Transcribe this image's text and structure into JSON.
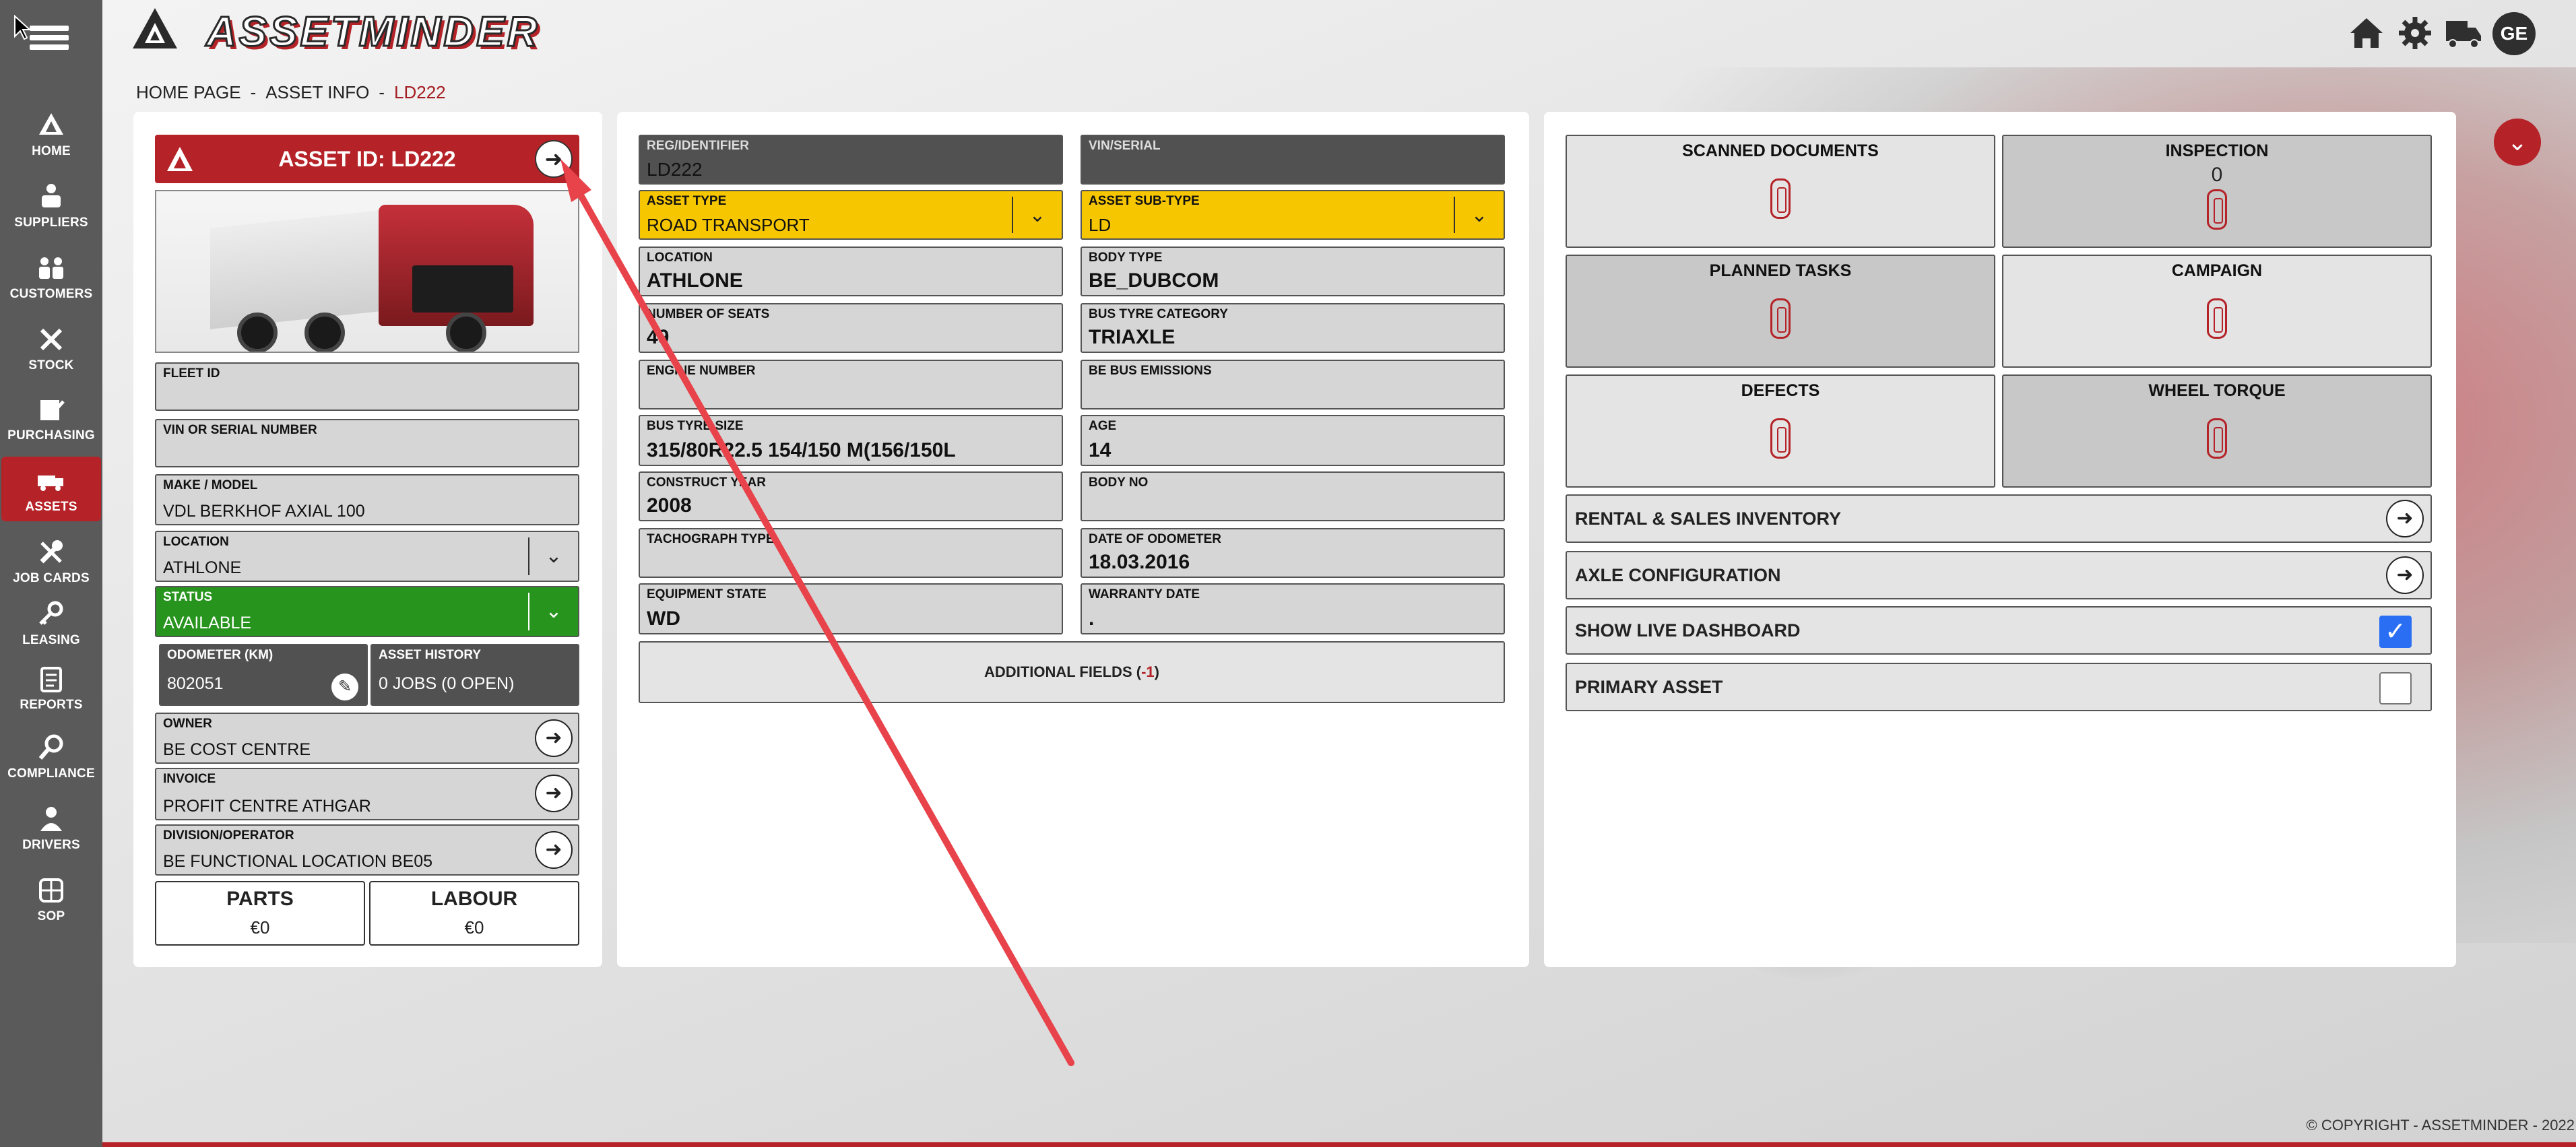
{
  "app": {
    "title": "ASSETMINDER"
  },
  "sidebar": {
    "items": [
      {
        "label": "HOME",
        "icon": "home-icon"
      },
      {
        "label": "SUPPLIERS",
        "icon": "suppliers-icon"
      },
      {
        "label": "CUSTOMERS",
        "icon": "customers-icon"
      },
      {
        "label": "STOCK",
        "icon": "stock-icon"
      },
      {
        "label": "PURCHASING",
        "icon": "purchasing-icon"
      },
      {
        "label": "ASSETS",
        "icon": "truck-icon",
        "active": true
      },
      {
        "label": "JOB CARDS",
        "icon": "wrench-icon"
      },
      {
        "label": "LEASING",
        "icon": "key-icon"
      },
      {
        "label": "REPORTS",
        "icon": "clipboard-icon"
      },
      {
        "label": "COMPLIANCE",
        "icon": "magnifier-icon"
      },
      {
        "label": "DRIVERS",
        "icon": "driver-icon"
      },
      {
        "label": "SOP",
        "icon": "sop-icon"
      }
    ]
  },
  "header": {
    "avatar": "GE",
    "icons": [
      "home-icon",
      "gear-icon",
      "truck-icon"
    ]
  },
  "breadcrumb": {
    "home": "HOME PAGE",
    "info": "ASSET INFO",
    "current": "LD222",
    "sep": "-"
  },
  "asset": {
    "header_title": "ASSET ID: LD222",
    "fleet_id": {
      "label": "FLEET ID",
      "value": ""
    },
    "vin": {
      "label": "VIN OR SERIAL NUMBER",
      "value": ""
    },
    "make_model": {
      "label": "MAKE / MODEL",
      "value": "VDL BERKHOF AXIAL 100"
    },
    "location": {
      "label": "LOCATION",
      "value": "ATHLONE"
    },
    "status": {
      "label": "STATUS",
      "value": "AVAILABLE"
    },
    "odometer": {
      "label": "ODOMETER (KM)",
      "value": "802051"
    },
    "history": {
      "label": "ASSET HISTORY",
      "value": "0 JOBS (0 OPEN)"
    },
    "owner": {
      "label": "OWNER",
      "value": "BE COST CENTRE"
    },
    "invoice": {
      "label": "INVOICE",
      "value": "PROFIT CENTRE ATHGAR"
    },
    "division": {
      "label": "DIVISION/OPERATOR",
      "value": "BE FUNCTIONAL LOCATION BE05"
    },
    "parts": {
      "label": "PARTS",
      "value": "€0"
    },
    "labour": {
      "label": "LABOUR",
      "value": "€0"
    }
  },
  "details": {
    "reg": {
      "label": "REG/IDENTIFIER",
      "value": "LD222"
    },
    "vin_serial": {
      "label": "VIN/SERIAL",
      "value": ""
    },
    "asset_type": {
      "label": "ASSET TYPE",
      "value": "ROAD TRANSPORT"
    },
    "asset_sub_type": {
      "label": "ASSET SUB-TYPE",
      "value": "LD"
    },
    "location": {
      "label": "LOCATION",
      "value": "ATHLONE"
    },
    "body_type": {
      "label": "BODY TYPE",
      "value": "BE_DUBCOM"
    },
    "seats": {
      "label": "NUMBER OF SEATS",
      "value": "49"
    },
    "tyre_category": {
      "label": "BUS TYRE CATEGORY",
      "value": "TRIAXLE"
    },
    "engine": {
      "label": "ENGINE NUMBER",
      "value": ""
    },
    "emissions": {
      "label": "BE BUS EMISSIONS",
      "value": ""
    },
    "tyre_size": {
      "label": "BUS TYRE SIZE",
      "value": "315/80R22.5 154/150 M(156/150L"
    },
    "age": {
      "label": "AGE",
      "value": "14"
    },
    "construct_year": {
      "label": "CONSTRUCT YEAR",
      "value": "2008"
    },
    "body_no": {
      "label": "BODY NO",
      "value": ""
    },
    "tachograph": {
      "label": "TACHOGRAPH TYPE",
      "value": ""
    },
    "odometer_date": {
      "label": "DATE OF ODOMETER",
      "value": "18.03.2016"
    },
    "equipment_state": {
      "label": "EQUIPMENT STATE",
      "value": "WD"
    },
    "warranty": {
      "label": "WARRANTY DATE",
      "value": "."
    },
    "additional_label": "ADDITIONAL FIELDS (",
    "additional_count": "-1",
    "additional_close": ")"
  },
  "tiles": [
    {
      "title": "SCANNED DOCUMENTS",
      "count": ""
    },
    {
      "title": "INSPECTION",
      "count": "0"
    },
    {
      "title": "PLANNED TASKS",
      "count": ""
    },
    {
      "title": "CAMPAIGN",
      "count": ""
    },
    {
      "title": "DEFECTS",
      "count": ""
    },
    {
      "title": "WHEEL TORQUE",
      "count": ""
    }
  ],
  "rows": {
    "rental": "RENTAL & SALES INVENTORY",
    "axle": "AXLE CONFIGURATION",
    "live": "SHOW LIVE DASHBOARD",
    "live_checked": true,
    "primary": "PRIMARY ASSET",
    "primary_checked": false
  },
  "footer": {
    "copyright": "© COPYRIGHT - ASSETMINDER - 2022"
  },
  "colors": {
    "brand_red": "#b52227",
    "sidebar": "#5a5a5a",
    "yellow": "#f6c600",
    "green": "#27941d",
    "checkbox_blue": "#2a6ff3"
  }
}
